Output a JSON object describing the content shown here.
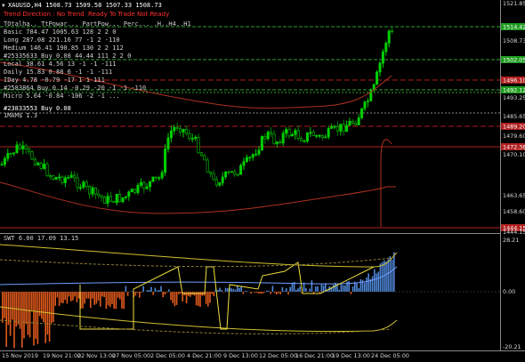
{
  "window": {
    "symbol_line": "XAUUSD,H4  1508.73 1509.58 1507.33 1508.73"
  },
  "status": {
    "items": [
      "Trend Direction : No Trend",
      "Ready To Trade",
      "Not Ready"
    ]
  },
  "table": {
    "header": "TOtalha.. TtPowar... PartPow... Perc... .H..H4..H1",
    "rows": [
      "Basic    784.47   1005.63   128   2   2   0",
      "Long     287.08   221.16    77   -1   2  -110",
      "Medium   146.41   190.85    130   2   2   112",
      "#25335633 Buy 0.08   44.44   111   2   2   0",
      "Local     38.61     4.56     13   -1   -1  -111",
      "Daily     15.83     0.88      6   -1   -1  -111",
      "IDay      4.78     -0.79    -17   1    1   111",
      "#2583864 Buy 0.14  -0.29    -20   -1   -1  -110",
      "Micro     5.64     -0.84   -106   -2   -1   ..."
    ],
    "extra_lines": [
      "#23833553 Buy 0.08",
      "1MAM$ 1.3"
    ]
  },
  "price_axis": {
    "labels": [
      "1521.85",
      "1508.73",
      "1493.25",
      "1485.65",
      "1479.60",
      "1470.10",
      "1463.65",
      "1458.60",
      "1444.15"
    ],
    "boxed": [
      {
        "text": "1514.42",
        "color": "#1e9b1e"
      },
      {
        "text": "1502.05",
        "color": "#1e9b1e"
      },
      {
        "text": "1496.10",
        "color": "#b02020"
      },
      {
        "text": "1492.12",
        "color": "#1e9b1e"
      },
      {
        "text": "1489.20",
        "color": "#b02020"
      },
      {
        "text": "1472.38",
        "color": "#b02020"
      },
      {
        "text": "1444.15",
        "color": "#b02020"
      }
    ]
  },
  "indicator": {
    "title": "SWT 6.00 17.09 13.15",
    "axis_labels": [
      "28.21",
      "0.00",
      "-20.21"
    ]
  },
  "time_axis": {
    "labels": [
      "15 Nov 2019",
      "19 Nov 21:00",
      "22 Nov 13:00",
      "27 Nov 05:00",
      "2 Dec 05:00",
      "4 Dec 21:00",
      "9 Dec 13:00",
      "12 Dec 05:00",
      "16 Dec 21:00",
      "19 Dec 13:00",
      "24 Dec 05:00"
    ]
  },
  "colors": {
    "bull_candle": "#00d000",
    "bear_candle": "#008000",
    "ma_line": "#b03020",
    "level_green": "#2fa02f",
    "level_red": "#b02020",
    "histogram_pos": "#4f86d8",
    "histogram_neg": "#e25a1c",
    "envelope": "#d0c030"
  },
  "icons": [
    "dropdown-triangle-icon"
  ]
}
